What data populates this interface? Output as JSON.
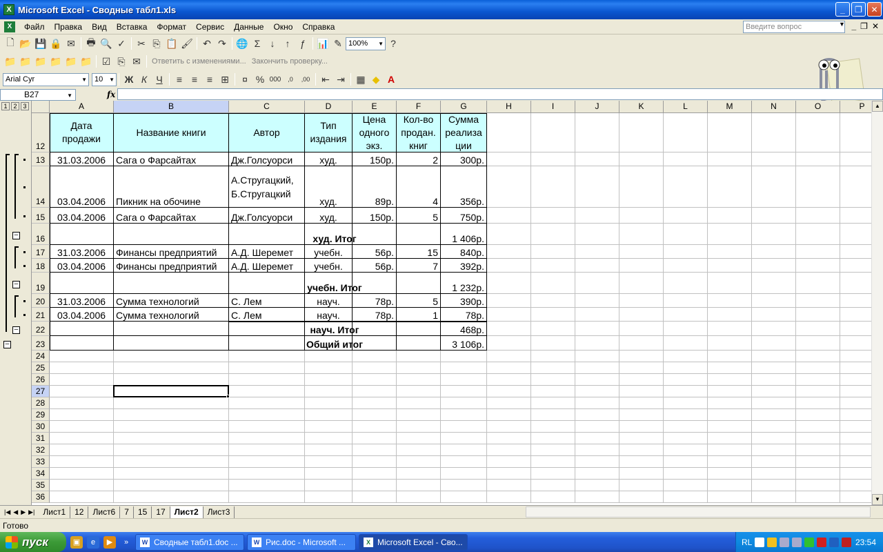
{
  "window": {
    "title": "Microsoft Excel - Сводные табл1.xls"
  },
  "menu": [
    "Файл",
    "Правка",
    "Вид",
    "Вставка",
    "Формат",
    "Сервис",
    "Данные",
    "Окно",
    "Справка"
  ],
  "ask_placeholder": "Введите вопрос",
  "toolbar": {
    "zoom": "100%",
    "font": "Arial Cyr",
    "size": "10",
    "review_reply": "Ответить с изменениями...",
    "review_end": "Закончить проверку..."
  },
  "formula": {
    "namebox": "B27",
    "fx": "fx"
  },
  "outline_levels": [
    "1",
    "2",
    "3"
  ],
  "columns": [
    "A",
    "B",
    "C",
    "D",
    "E",
    "F",
    "G",
    "H",
    "I",
    "J",
    "K",
    "L",
    "M",
    "N",
    "O",
    "P"
  ],
  "rows": [
    "12",
    "13",
    "14",
    "15",
    "16",
    "17",
    "18",
    "19",
    "20",
    "21",
    "22",
    "23",
    "24",
    "25",
    "26",
    "27",
    "28",
    "29",
    "30",
    "31",
    "32",
    "33",
    "34",
    "35",
    "36"
  ],
  "headers": {
    "a": "Дата продажи",
    "b": "Название книги",
    "c": "Автор",
    "d": "Тип издания",
    "e": "Цена одного экз.",
    "f": "Кол-во продан. книг",
    "g": "Сумма реализа ции"
  },
  "data": [
    {
      "date": "31.03.2006",
      "book": "Сага о Фарсайтах",
      "author": "Дж.Голсуорси",
      "type": "худ.",
      "price": "150р.",
      "qty": "2",
      "sum": "300р."
    },
    {
      "date": "03.04.2006",
      "book": "Пикник на обочине",
      "author": "А.Стругацкий, Б.Стругацкий",
      "type": "худ.",
      "price": "89р.",
      "qty": "4",
      "sum": "356р."
    },
    {
      "date": "03.04.2006",
      "book": "Сага о Фарсайтах",
      "author": "Дж.Голсуорси",
      "type": "худ.",
      "price": "150р.",
      "qty": "5",
      "sum": "750р."
    },
    {
      "label": "худ. Итог",
      "sum": "1 406р."
    },
    {
      "date": "31.03.2006",
      "book": "Финансы предприятий",
      "author": "А.Д. Шеремет",
      "type": "учебн.",
      "price": "56р.",
      "qty": "15",
      "sum": "840р."
    },
    {
      "date": "03.04.2006",
      "book": "Финансы предприятий",
      "author": "А.Д. Шеремет",
      "type": "учебн.",
      "price": "56р.",
      "qty": "7",
      "sum": "392р."
    },
    {
      "label": "учебн. Итог",
      "sum": "1 232р."
    },
    {
      "date": "31.03.2006",
      "book": "Сумма технологий",
      "author": "С. Лем",
      "type": "науч.",
      "price": "78р.",
      "qty": "5",
      "sum": "390р."
    },
    {
      "date": "03.04.2006",
      "book": "Сумма технологий",
      "author": "С. Лем",
      "type": "науч.",
      "price": "78р.",
      "qty": "1",
      "sum": "78р."
    },
    {
      "label": "науч. Итог",
      "sum": "468р."
    },
    {
      "label": "Общий итог",
      "sum": "3 106р."
    }
  ],
  "tabs": [
    "Лист1",
    "12",
    "Лист6",
    "7",
    "15",
    "17",
    "Лист2",
    "Лист3"
  ],
  "active_tab": "Лист2",
  "status": "Готово",
  "taskbar": {
    "start": "пуск",
    "tasks": [
      "Сводные табл1.doc ...",
      "Рис.doc - Microsoft ...",
      "Microsoft Excel - Сво..."
    ],
    "lang": "RL",
    "clock": "23:54"
  }
}
